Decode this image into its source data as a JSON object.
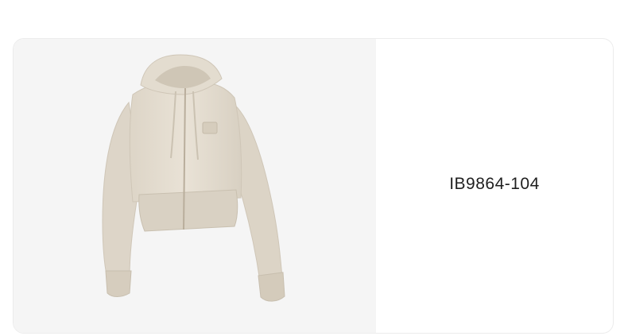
{
  "product": {
    "code": "IB9864-104",
    "image": {
      "subject": "cropped-zip-hoodie",
      "color": "#e6dfd3"
    }
  },
  "colors": {
    "card_background": "#ffffff",
    "image_background": "#f5f5f5",
    "garment": "#e6dfd3",
    "text": "#1f1f1f"
  }
}
